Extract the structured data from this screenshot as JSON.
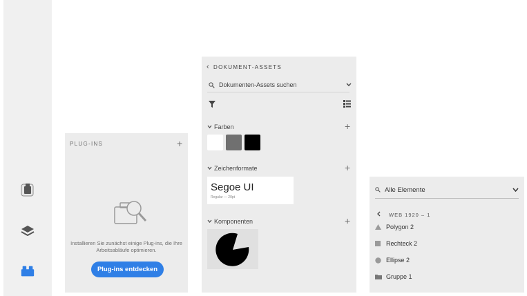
{
  "rail": {
    "icons": [
      "plugins-panel-icon",
      "layers-icon",
      "assets-icon"
    ],
    "accent": "#2f7fe6"
  },
  "plugins": {
    "heading": "PLUG-INS",
    "add_icon": "+",
    "empty_text": "Installieren Sie zunächst einige Plug-ins, die Ihre Arbeitsabläufe optimieren.",
    "discover_button": "Plug-ins entdecken"
  },
  "assets": {
    "back_icon": "‹",
    "heading": "DOKUMENT-ASSETS",
    "search_placeholder": "Dokumenten-Assets suchen",
    "colors": {
      "label": "Farben",
      "swatches": [
        "#ffffff",
        "#707070",
        "#000000"
      ]
    },
    "character_styles": {
      "label": "Zeichenformate",
      "font_name": "Segoe UI",
      "font_meta": "Regular — 20pt"
    },
    "components": {
      "label": "Komponenten"
    }
  },
  "layers": {
    "search_value": "Alle Elemente",
    "artboard": "WEB 1920 – 1",
    "items": [
      {
        "icon": "polygon-icon",
        "label": "Polygon 2"
      },
      {
        "icon": "rectangle-icon",
        "label": "Rechteck 2"
      },
      {
        "icon": "ellipse-icon",
        "label": "Ellipse 2"
      },
      {
        "icon": "group-folder-icon",
        "label": "Gruppe 1"
      }
    ]
  }
}
